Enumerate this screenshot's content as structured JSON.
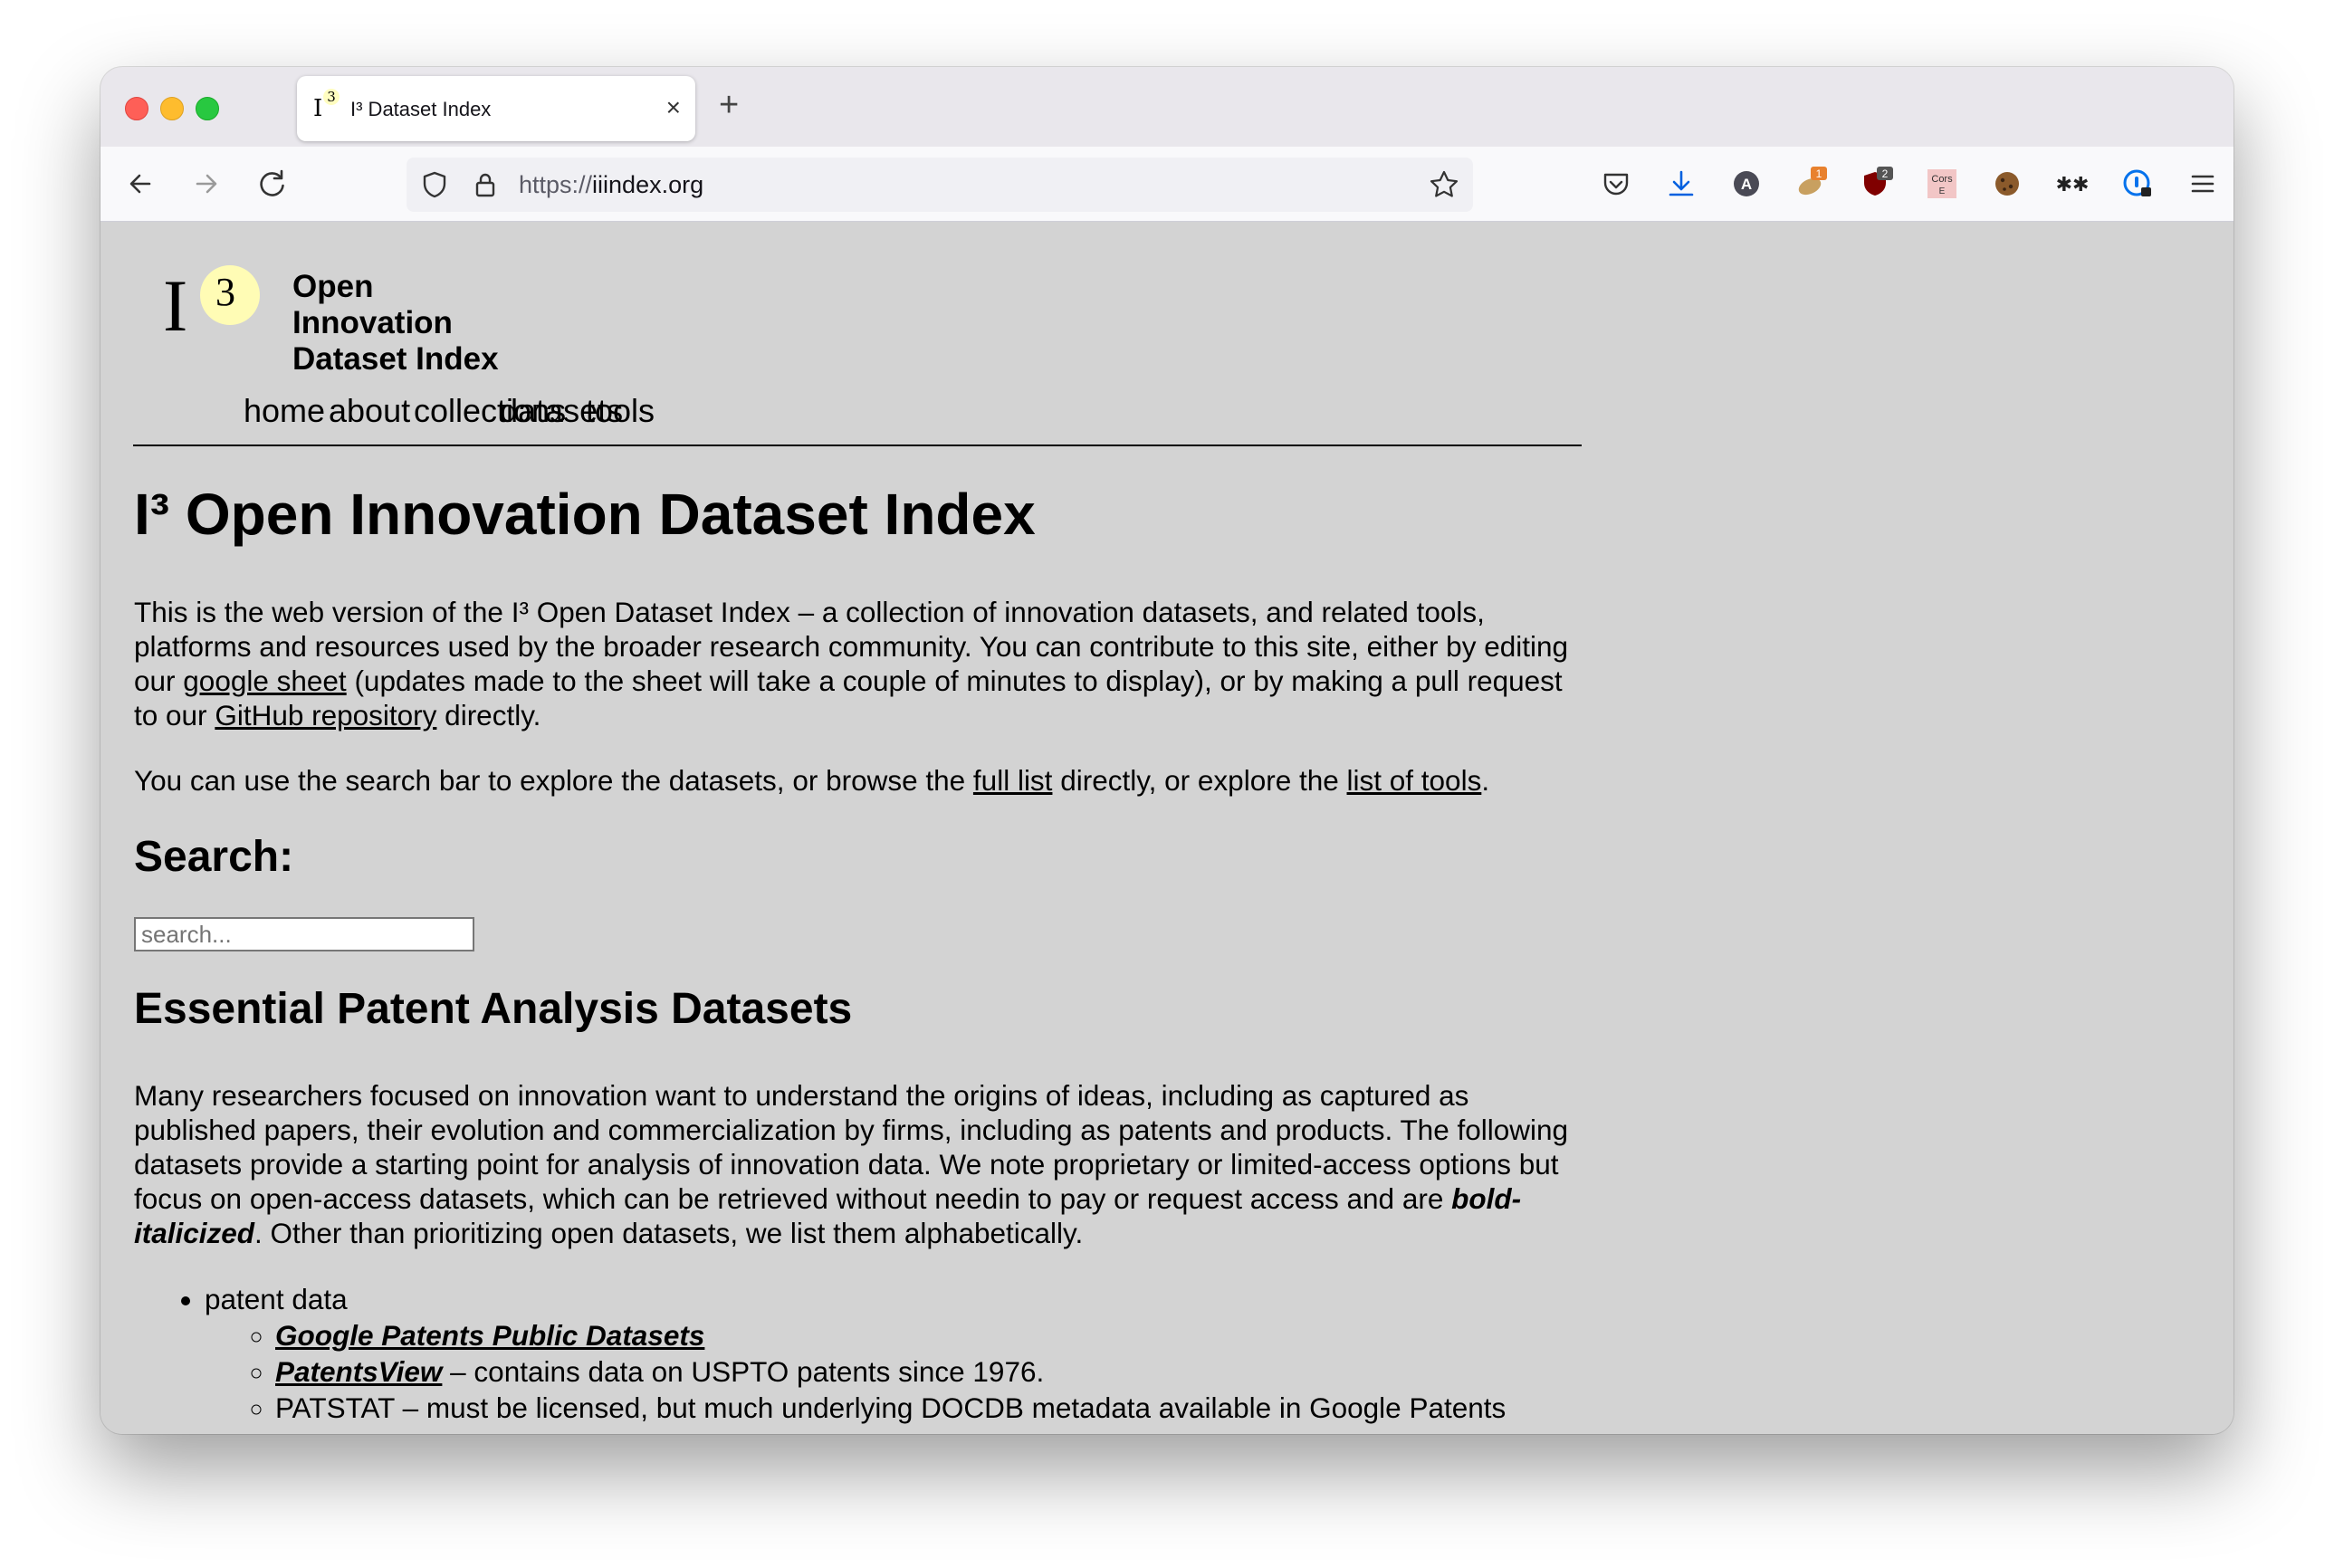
{
  "browser": {
    "tab": {
      "title": "I³ Dataset Index",
      "close_icon": "×"
    },
    "new_tab_label": "+",
    "url": {
      "scheme": "https://",
      "host": "iiindex.org"
    },
    "extensions": [
      {
        "name": "pocket-icon"
      },
      {
        "name": "download-icon"
      },
      {
        "name": "account-icon",
        "label": "A"
      },
      {
        "name": "extension-badge-icon",
        "badge": "1"
      },
      {
        "name": "ublock-icon",
        "badge": "2"
      },
      {
        "name": "cors-icon",
        "label": "Cors E"
      },
      {
        "name": "cookie-icon"
      },
      {
        "name": "asterisk-icon",
        "label": "✱✱"
      },
      {
        "name": "password-manager-icon"
      },
      {
        "name": "menu-icon"
      }
    ]
  },
  "logo": {
    "i": "I",
    "three": "3",
    "line1": "Open Innovation",
    "line2": "Dataset Index"
  },
  "nav": [
    "home",
    "about",
    "collections",
    "datasets",
    "tools"
  ],
  "page": {
    "title": "I³ Open Innovation Dataset Index",
    "intro": {
      "t1": "This is the web version of the I³ Open Dataset Index – a collection of innovation datasets, and related tools, platforms and resources used by the broader research community. You can contribute to this site, either by editing our ",
      "link1": "google sheet",
      "t2": " (updates made to the sheet will take a couple of minutes to display), or by making a pull request to our ",
      "link2": "GitHub repository",
      "t3": " directly."
    },
    "browse": {
      "t1": "You can use the search bar to explore the datasets, or browse the ",
      "link1": "full list",
      "t2": " directly, or explore the ",
      "link2": "list of tools",
      "t3": "."
    },
    "search_heading": "Search:",
    "search_placeholder": "search...",
    "section_heading": "Essential Patent Analysis Datasets",
    "section_text": {
      "t1": "Many researchers focused on innovation want to understand the origins of ideas, including as captured as published papers, their evolution and commercialization by firms, including as patents and products. The following datasets provide a starting point for analysis of innovation data. We note proprietary or limited-access options but focus on open-access datasets, which can be retrieved without needin to pay or request access and are ",
      "bold": "bold-italicized",
      "t2": ". Other than prioritizing open datasets, we list them alphabetically."
    },
    "list": {
      "category": "patent data",
      "items": [
        {
          "link": "Google Patents Public Datasets",
          "desc": ""
        },
        {
          "link": "PatentsView",
          "desc": " – contains data on USPTO patents since 1976."
        },
        {
          "text": "PATSTAT – must be licensed, but much underlying DOCDB metadata available in Google Patents"
        }
      ]
    }
  }
}
